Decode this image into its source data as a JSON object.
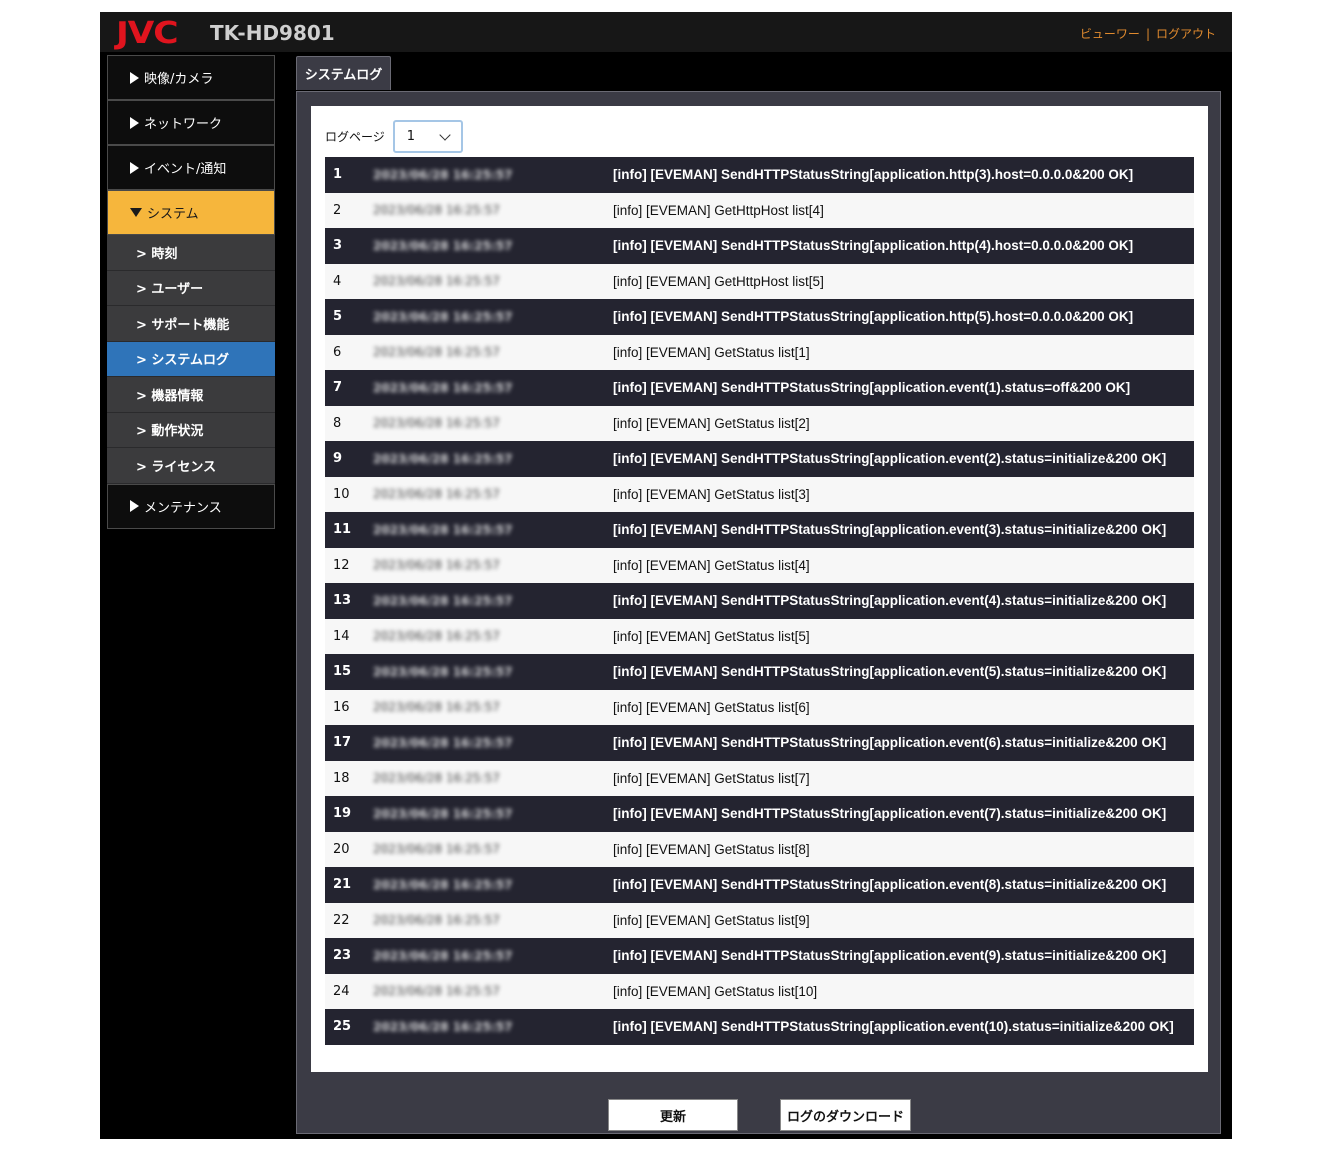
{
  "header": {
    "logo": "JVC",
    "model": "TK-HD9801",
    "viewer_link": "ビューワー",
    "separator": "|",
    "logout_link": "ログアウト"
  },
  "sidebar": {
    "items": [
      {
        "label": "映像/カメラ"
      },
      {
        "label": "ネットワーク"
      },
      {
        "label": "イベント/通知"
      },
      {
        "label": "システム"
      }
    ],
    "sub_items": [
      {
        "label": "> 時刻"
      },
      {
        "label": "> ユーザー"
      },
      {
        "label": "> サポート機能"
      },
      {
        "label": "> システムログ"
      },
      {
        "label": "> 機器情報"
      },
      {
        "label": "> 動作状況"
      },
      {
        "label": "> ライセンス"
      }
    ],
    "last_item": {
      "label": "メンテナンス"
    },
    "selected_sub": "> システムログ",
    "active_color": "#f6b63c",
    "selected_color": "#2f74b9"
  },
  "tab": {
    "label": "システムログ"
  },
  "log_page": {
    "label": "ログページ",
    "selected": "1"
  },
  "log_rows": [
    {
      "num": "1",
      "timestamp": "2023/06/28 16:25:57",
      "message": "[info] [EVEMAN] SendHTTPStatusString[application.http(3).host=0.0.0.0&200 OK]"
    },
    {
      "num": "2",
      "timestamp": "2023/06/28 16:25:57",
      "message": "[info] [EVEMAN] GetHttpHost list[4]"
    },
    {
      "num": "3",
      "timestamp": "2023/06/28 16:25:57",
      "message": "[info] [EVEMAN] SendHTTPStatusString[application.http(4).host=0.0.0.0&200 OK]"
    },
    {
      "num": "4",
      "timestamp": "2023/06/28 16:25:57",
      "message": "[info] [EVEMAN] GetHttpHost list[5]"
    },
    {
      "num": "5",
      "timestamp": "2023/06/28 16:25:57",
      "message": "[info] [EVEMAN] SendHTTPStatusString[application.http(5).host=0.0.0.0&200 OK]"
    },
    {
      "num": "6",
      "timestamp": "2023/06/28 16:25:57",
      "message": "[info] [EVEMAN] GetStatus list[1]"
    },
    {
      "num": "7",
      "timestamp": "2023/06/28 16:25:57",
      "message": "[info] [EVEMAN] SendHTTPStatusString[application.event(1).status=off&200 OK]"
    },
    {
      "num": "8",
      "timestamp": "2023/06/28 16:25:57",
      "message": "[info] [EVEMAN] GetStatus list[2]"
    },
    {
      "num": "9",
      "timestamp": "2023/06/28 16:25:57",
      "message": "[info] [EVEMAN] SendHTTPStatusString[application.event(2).status=initialize&200 OK]"
    },
    {
      "num": "10",
      "timestamp": "2023/06/28 16:25:57",
      "message": "[info] [EVEMAN] GetStatus list[3]"
    },
    {
      "num": "11",
      "timestamp": "2023/06/28 16:25:57",
      "message": "[info] [EVEMAN] SendHTTPStatusString[application.event(3).status=initialize&200 OK]"
    },
    {
      "num": "12",
      "timestamp": "2023/06/28 16:25:57",
      "message": "[info] [EVEMAN] GetStatus list[4]"
    },
    {
      "num": "13",
      "timestamp": "2023/06/28 16:25:57",
      "message": "[info] [EVEMAN] SendHTTPStatusString[application.event(4).status=initialize&200 OK]"
    },
    {
      "num": "14",
      "timestamp": "2023/06/28 16:25:57",
      "message": "[info] [EVEMAN] GetStatus list[5]"
    },
    {
      "num": "15",
      "timestamp": "2023/06/28 16:25:57",
      "message": "[info] [EVEMAN] SendHTTPStatusString[application.event(5).status=initialize&200 OK]"
    },
    {
      "num": "16",
      "timestamp": "2023/06/28 16:25:57",
      "message": "[info] [EVEMAN] GetStatus list[6]"
    },
    {
      "num": "17",
      "timestamp": "2023/06/28 16:25:57",
      "message": "[info] [EVEMAN] SendHTTPStatusString[application.event(6).status=initialize&200 OK]"
    },
    {
      "num": "18",
      "timestamp": "2023/06/28 16:25:57",
      "message": "[info] [EVEMAN] GetStatus list[7]"
    },
    {
      "num": "19",
      "timestamp": "2023/06/28 16:25:57",
      "message": "[info] [EVEMAN] SendHTTPStatusString[application.event(7).status=initialize&200 OK]"
    },
    {
      "num": "20",
      "timestamp": "2023/06/28 16:25:57",
      "message": "[info] [EVEMAN] GetStatus list[8]"
    },
    {
      "num": "21",
      "timestamp": "2023/06/28 16:25:57",
      "message": "[info] [EVEMAN] SendHTTPStatusString[application.event(8).status=initialize&200 OK]"
    },
    {
      "num": "22",
      "timestamp": "2023/06/28 16:25:57",
      "message": "[info] [EVEMAN] GetStatus list[9]"
    },
    {
      "num": "23",
      "timestamp": "2023/06/28 16:25:57",
      "message": "[info] [EVEMAN] SendHTTPStatusString[application.event(9).status=initialize&200 OK]"
    },
    {
      "num": "24",
      "timestamp": "2023/06/28 16:25:57",
      "message": "[info] [EVEMAN] GetStatus list[10]"
    },
    {
      "num": "25",
      "timestamp": "2023/06/28 16:25:57",
      "message": "[info] [EVEMAN] SendHTTPStatusString[application.event(10).status=initialize&200 OK]"
    }
  ],
  "buttons": {
    "refresh": "更新",
    "download": "ログのダウンロード"
  }
}
